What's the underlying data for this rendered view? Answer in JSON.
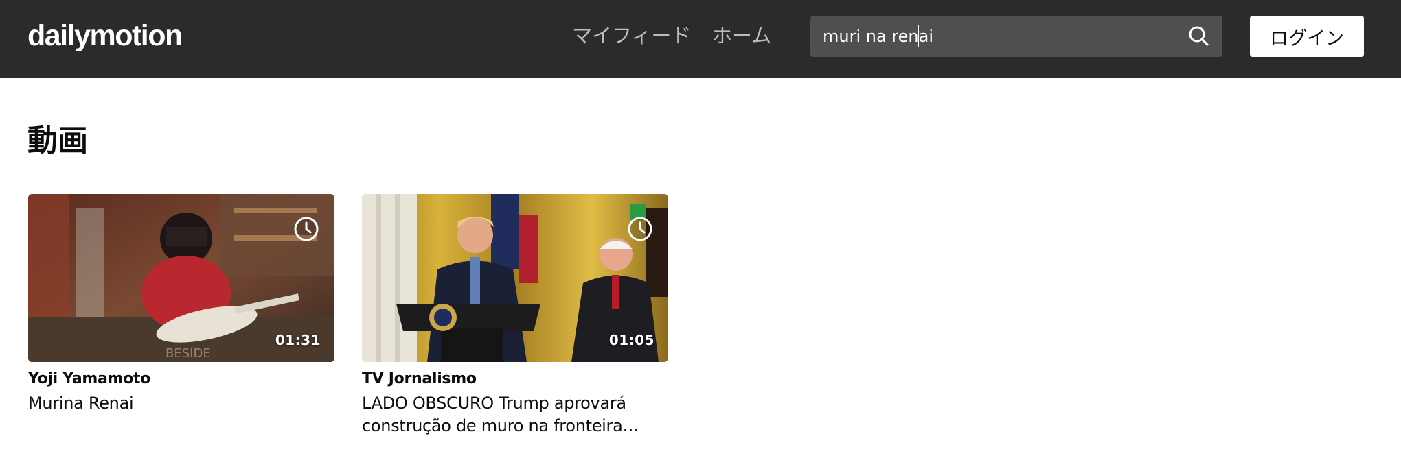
{
  "header": {
    "logo": "dailymotion",
    "nav": {
      "feed": "マイフィード",
      "home": "ホーム"
    },
    "search": {
      "value": "muri na renai",
      "icon": "search-icon"
    },
    "login_label": "ログイン"
  },
  "section": {
    "title": "動画"
  },
  "videos": [
    {
      "channel": "Yoji Yamamoto",
      "title": "Murina Renai",
      "duration": "01:31",
      "overlay_icon": "clock-icon"
    },
    {
      "channel": "TV Jornalismo",
      "title": "LADO OBSCURO Trump aprovará construção de muro na fronteira com…",
      "duration": "01:05",
      "overlay_icon": "clock-icon"
    }
  ],
  "colors": {
    "header_bg": "#2b2b2b",
    "search_bg": "#4f4f4f",
    "nav_text": "#bcbcbc"
  }
}
